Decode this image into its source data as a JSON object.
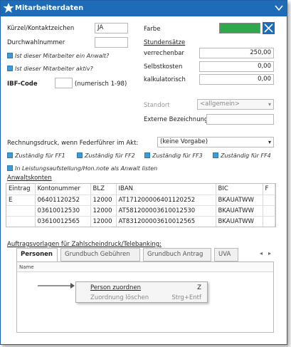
{
  "window": {
    "title": "Mitarbeiterdaten"
  },
  "fields": {
    "kuerzel_label": "Kürzel/Kontaktzeichen",
    "kuerzel_value": "JA",
    "durchwahl_label": "Durchwahlnummer",
    "durchwahl_value": "",
    "farbe_label": "Farbe",
    "farbe_color": "#2ea84a",
    "anwalt_check": "Ist dieser Mitarbeiter ein Anwalt?",
    "aktiv_check": "Ist dieser Mitarbeiter aktiv?",
    "ibf_label": "IBF-Code",
    "ibf_value": "",
    "ibf_hint": "(numerisch 1-98)",
    "stundensaetze_link": "Stundensätze",
    "verrechenbar_label": "verrechenbar",
    "verrechenbar_value": "250,00",
    "selbstkosten_label": "Selbstkosten",
    "selbstkosten_value": "0,00",
    "kalkulatorisch_label": "kalkulatorisch",
    "kalkulatorisch_value": "0,00",
    "standort_label": "Standort",
    "standort_value": "<allgemein>",
    "externe_label": "Externe Bezeichnung",
    "externe_value": "",
    "rechnungsdruck_label": "Rechnungsdruck, wenn Federführer im Akt:",
    "rechnungsdruck_value": "(keine Vorgabe)",
    "zustaendig": [
      "Zuständig für FF1",
      "Zuständig für FF2",
      "Zuständig für FF3",
      "Zuständig für FF4"
    ],
    "leistungsaufstellung": "In Leistungsaufstellung/Hon.note als Anwalt listen"
  },
  "anwaltskonten": {
    "title": "Anwaltskonten",
    "columns": [
      "Eintrag",
      "Kontonummer",
      "BLZ",
      "IBAN",
      "BIC",
      "F"
    ],
    "rows": [
      [
        "E",
        "06401120252",
        "12000",
        "AT171200006401120252",
        "BKAUATWW",
        ""
      ],
      [
        "",
        "03610012530",
        "12000",
        "AT581200003610012530",
        "BKAUATWW",
        ""
      ],
      [
        "",
        "03610012565",
        "12000",
        "AT831200003610012565",
        "BKAUATWW",
        ""
      ]
    ]
  },
  "auftrag_link": "Auftragsvorlagen für Zahlscheindruck/Telebanking:",
  "tabs": [
    "Personen",
    "Grundbuch Gebühren",
    "Grundbuch Antrag",
    "UVA"
  ],
  "panel": {
    "header": "Name"
  },
  "context_menu": [
    {
      "label": "Person zuordnen",
      "shortcut": "Z",
      "enabled": true
    },
    {
      "label": "Zuordnung löschen",
      "shortcut": "Strg+Entf",
      "enabled": false
    }
  ]
}
